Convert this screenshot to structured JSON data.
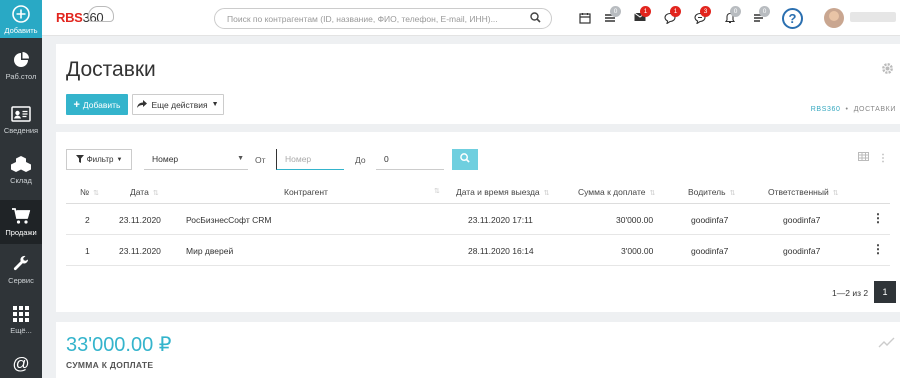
{
  "sidebar": {
    "top": {
      "label": "Добавить",
      "icon": "plus-circle-icon"
    },
    "items": [
      {
        "label": "Раб.стол",
        "icon": "pie-chart-icon"
      },
      {
        "label": "Сведения",
        "icon": "contact-card-icon"
      },
      {
        "label": "Склад",
        "icon": "boxes-icon"
      },
      {
        "label": "Продажи",
        "icon": "shopping-cart-icon"
      },
      {
        "label": "Сервис",
        "icon": "wrench-icon"
      },
      {
        "label": "Ещё...",
        "icon": "grid-icon"
      },
      {
        "label": "",
        "icon": "at-icon"
      }
    ]
  },
  "topbar": {
    "logo_text": "RBS",
    "logo_num": "360",
    "search_placeholder": "Поиск по контрагентам (ID, название, ФИО, телефон, E-mail, ИНН)...",
    "badges": [
      "0",
      "1",
      "1",
      "3",
      "0",
      "0"
    ]
  },
  "header": {
    "title": "Доставки",
    "add_label": "Добавить",
    "more_label": "Еще действия",
    "breadcrumb_root": "RBS360",
    "breadcrumb_current": "ДОСТАВКИ"
  },
  "filters": {
    "filter_label": "Фильтр",
    "field_select": "Номер",
    "from_label": "От",
    "from_placeholder": "Номер",
    "to_label": "До",
    "to_value": "0"
  },
  "table": {
    "columns": [
      "№",
      "Дата",
      "Контрагент",
      "Дата и время выезда",
      "Сумма к доплате",
      "Водитель",
      "Ответственный"
    ],
    "rows": [
      {
        "num": "2",
        "date": "23.11.2020",
        "counterparty": "РосБизнесСофт CRM",
        "departure": "23.11.2020 17:11",
        "amount": "30'000.00",
        "driver": "goodinfa7",
        "responsible": "goodinfa7"
      },
      {
        "num": "1",
        "date": "23.11.2020",
        "counterparty": "Мир дверей",
        "departure": "28.11.2020 16:14",
        "amount": "3'000.00",
        "driver": "goodinfa7",
        "responsible": "goodinfa7"
      }
    ]
  },
  "pagination": {
    "summary": "1—2 из 2",
    "current_page": "1"
  },
  "summary": {
    "value": "33'000.00 ₽",
    "label": "СУММА К ДОПЛАТЕ"
  },
  "colors": {
    "accent": "#34b4cc",
    "sidebar": "#2f3438",
    "badge_red": "#e2251e"
  }
}
